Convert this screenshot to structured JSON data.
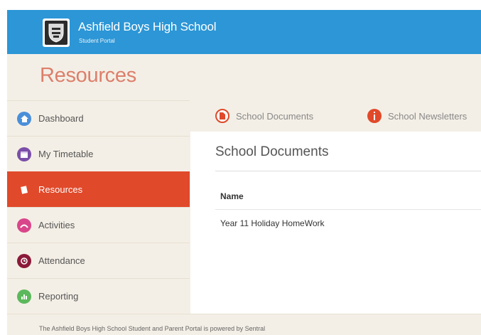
{
  "header": {
    "school_name": "Ashfield Boys High School",
    "portal_name": "Student Portal",
    "brand_color": "#2c96d6",
    "logo_icon": "school-crest-icon"
  },
  "page": {
    "title": "Resources"
  },
  "sidebar": {
    "items": [
      {
        "label": "Dashboard",
        "icon": "dashboard-icon",
        "color": "#4a8fd9",
        "active": false
      },
      {
        "label": "My Timetable",
        "icon": "calendar-icon",
        "color": "#7a4fa8",
        "active": false
      },
      {
        "label": "Resources",
        "icon": "resources-icon",
        "color": "#e0492a",
        "active": true
      },
      {
        "label": "Activities",
        "icon": "activities-icon",
        "color": "#d9458a",
        "active": false
      },
      {
        "label": "Attendance",
        "icon": "attendance-icon",
        "color": "#8b1a3a",
        "active": false
      },
      {
        "label": "Reporting",
        "icon": "reporting-icon",
        "color": "#5cb85c",
        "active": false
      }
    ]
  },
  "tabs": [
    {
      "label": "School Documents",
      "icon": "document-icon",
      "color": "#e0492a",
      "active": true
    },
    {
      "label": "School Newsletters",
      "icon": "newsletter-icon",
      "color": "#e0492a",
      "active": false
    }
  ],
  "main": {
    "section_title": "School Documents",
    "table": {
      "columns": [
        "Name"
      ],
      "rows": [
        [
          "Year 11 Holiday HomeWork"
        ]
      ]
    }
  },
  "footer": {
    "text": "The Ashfield Boys High School Student and Parent Portal is powered by Sentral"
  }
}
